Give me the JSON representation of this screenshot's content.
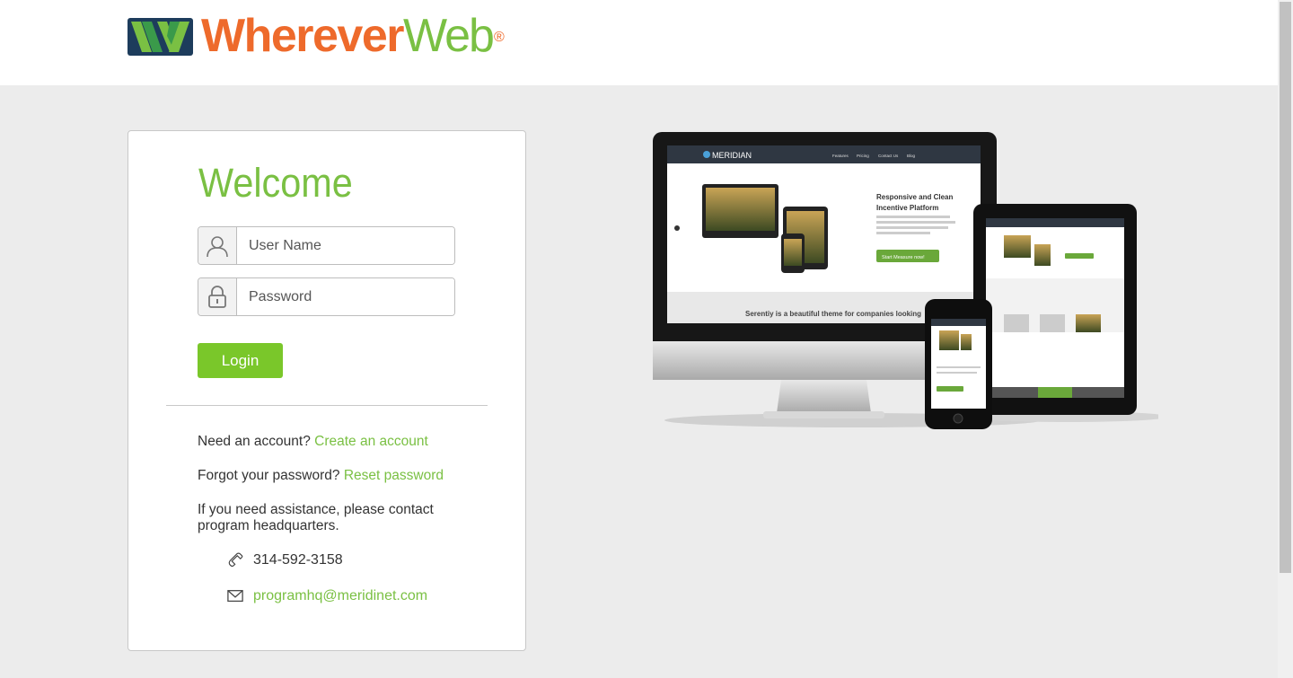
{
  "brand": {
    "name_part1": "Wherever",
    "name_part2": "Web",
    "registered": "®",
    "colors": {
      "orange": "#ee6a2b",
      "green": "#7ac043",
      "navy": "#1d3c5c"
    }
  },
  "login": {
    "title": "Welcome",
    "username_placeholder": "User Name",
    "password_placeholder": "Password",
    "login_label": "Login",
    "need_account_text": "Need an account?",
    "create_account_link": "Create an account",
    "forgot_text": "Forgot your password?",
    "reset_link": "Reset password",
    "assistance_text": "If you need assistance, please contact program headquarters.",
    "phone": "314-592-3158",
    "email": "programhq@meridinet.com"
  },
  "showcase": {
    "site_name": "MERIDIAN",
    "nav": [
      "Features",
      "Pricing",
      "Contact Us",
      "Blog"
    ],
    "headline": "Responsive and Clean Incentive Platform",
    "cta": "Start Measure now!",
    "tagline": "Serentiy is a beautiful theme for companies looking"
  }
}
